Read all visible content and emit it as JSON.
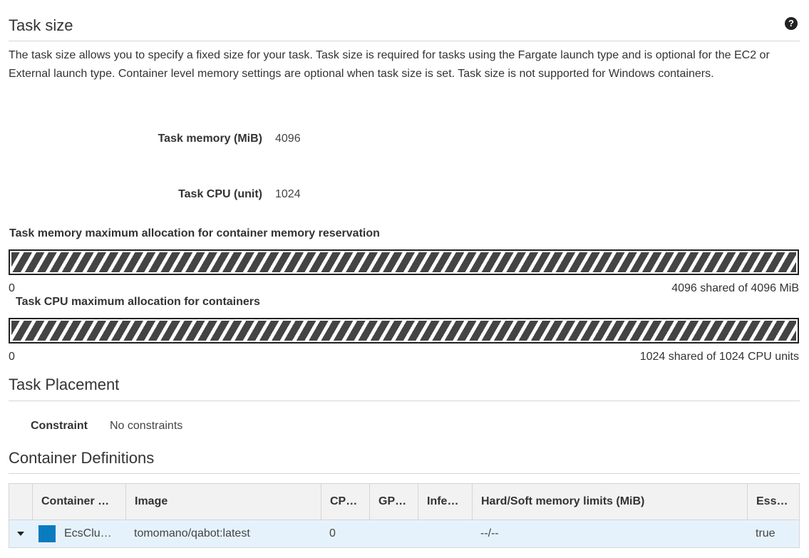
{
  "task_size": {
    "title": "Task size",
    "description": "The task size allows you to specify a fixed size for your task. Task size is required for tasks using the Fargate launch type and is optional for the EC2 or External launch type. Container level memory settings are optional when task size is set. Task size is not supported for Windows containers.",
    "memory_label": "Task memory (MiB)",
    "memory_value": "4096",
    "cpu_label": "Task CPU (unit)",
    "cpu_value": "1024",
    "help_icon": "question-circle-icon"
  },
  "memory_allocation": {
    "title": "Task memory maximum allocation for container memory reservation",
    "min_label": "0",
    "max_label": "4096 shared of 4096 MiB",
    "shared_fraction": 1.0
  },
  "cpu_allocation": {
    "title": "Task CPU maximum allocation for containers",
    "min_label": "0",
    "max_label": "1024 shared of 1024 CPU units",
    "shared_fraction": 1.0
  },
  "task_placement": {
    "title": "Task Placement",
    "constraint_label": "Constraint",
    "constraint_value": "No constraints"
  },
  "container_definitions": {
    "title": "Container Definitions",
    "columns": [
      "Container …",
      "Image",
      "CP…",
      "GP…",
      "Infe…",
      "Hard/Soft memory limits (MiB)",
      "Ess…"
    ],
    "rows": [
      {
        "name": "EcsClu…",
        "image": "tomomano/qabot:latest",
        "cpu": "0",
        "gpu": "",
        "inference": "",
        "memory_limits": "--/--",
        "essential": "true",
        "color": "#0a7bbf"
      }
    ]
  }
}
